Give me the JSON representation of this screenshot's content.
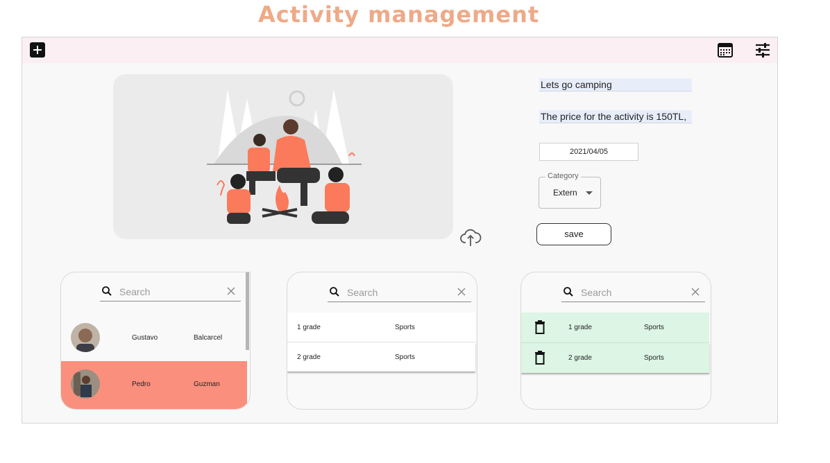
{
  "page": {
    "title": "Activity management"
  },
  "toolbar": {
    "add_icon": "add-icon",
    "calendar_icon": "calendar-icon",
    "filter_icon": "tune-icon"
  },
  "form": {
    "activity_name": "Lets go camping",
    "price_text": "The price for the activity is 150TL,",
    "date": "2021/04/05",
    "category_label": "Category",
    "category_value": "Extern",
    "save_label": "save",
    "upload_icon": "cloud-upload-icon"
  },
  "users_panel": {
    "search_placeholder": "Search",
    "rows": [
      {
        "first": "Gustavo",
        "last": "Balcarcel",
        "selected": false
      },
      {
        "first": "Pedro",
        "last": "Guzman",
        "selected": true
      }
    ]
  },
  "groups_panel": {
    "search_placeholder": "Search",
    "rows": [
      {
        "grade": "1 grade",
        "type": "Sports"
      },
      {
        "grade": "2 grade",
        "type": "Sports"
      }
    ]
  },
  "assigned_panel": {
    "search_placeholder": "Search",
    "rows": [
      {
        "grade": "1 grade",
        "type": "Sports"
      },
      {
        "grade": "2 grade",
        "type": "Sports"
      }
    ]
  },
  "colors": {
    "title": "#eeaa88",
    "toolbar_bg": "#fbeff4",
    "selected_row": "#fa8f7d",
    "assigned_row": "#dcf5e4",
    "illustration_accent": "#fb7a5c"
  }
}
